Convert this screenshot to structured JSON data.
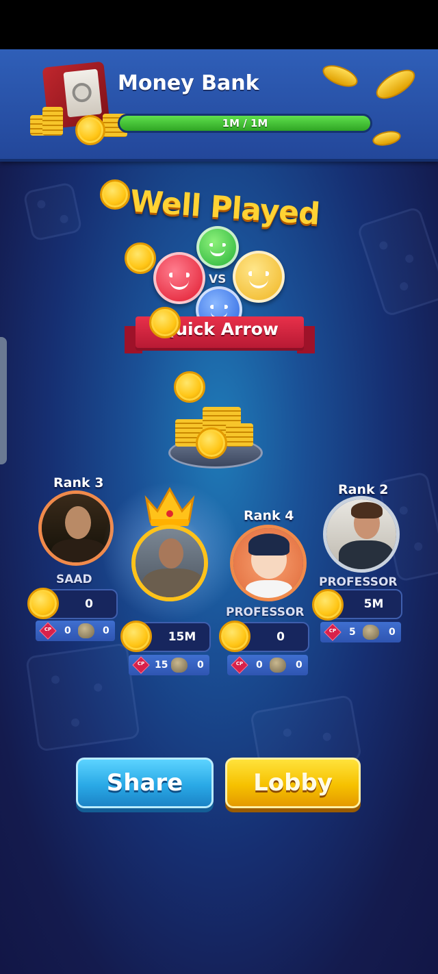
{
  "money_bank": {
    "title": "Money Bank",
    "progress_text": "1M / 1M",
    "progress_fraction": 1.0
  },
  "result": {
    "headline": "Well Played",
    "vs_label": "VS",
    "game_mode": "Quick Arrow"
  },
  "players": [
    {
      "slot": "left",
      "rank_label": "Rank 3",
      "name": "SAAD",
      "coins": "0",
      "gems": "0",
      "stones": "0"
    },
    {
      "slot": "center",
      "rank_label": "",
      "name": "",
      "coins": "15M",
      "gems": "15",
      "stones": "0"
    },
    {
      "slot": "center-right",
      "rank_label": "Rank 4",
      "name": "PROFESSOR",
      "coins": "0",
      "gems": "0",
      "stones": "0"
    },
    {
      "slot": "right",
      "rank_label": "Rank 2",
      "name": "PROFESSOR",
      "coins": "5M",
      "gems": "5",
      "stones": "0"
    }
  ],
  "gem_badge": "CP",
  "buttons": {
    "share": "Share",
    "lobby": "Lobby"
  },
  "colors": {
    "accent_gold": "#ffd234",
    "ribbon_red": "#e8304a",
    "share_blue": "#2aa9e6",
    "lobby_yellow": "#f6c100",
    "progress_green": "#2fa524"
  }
}
